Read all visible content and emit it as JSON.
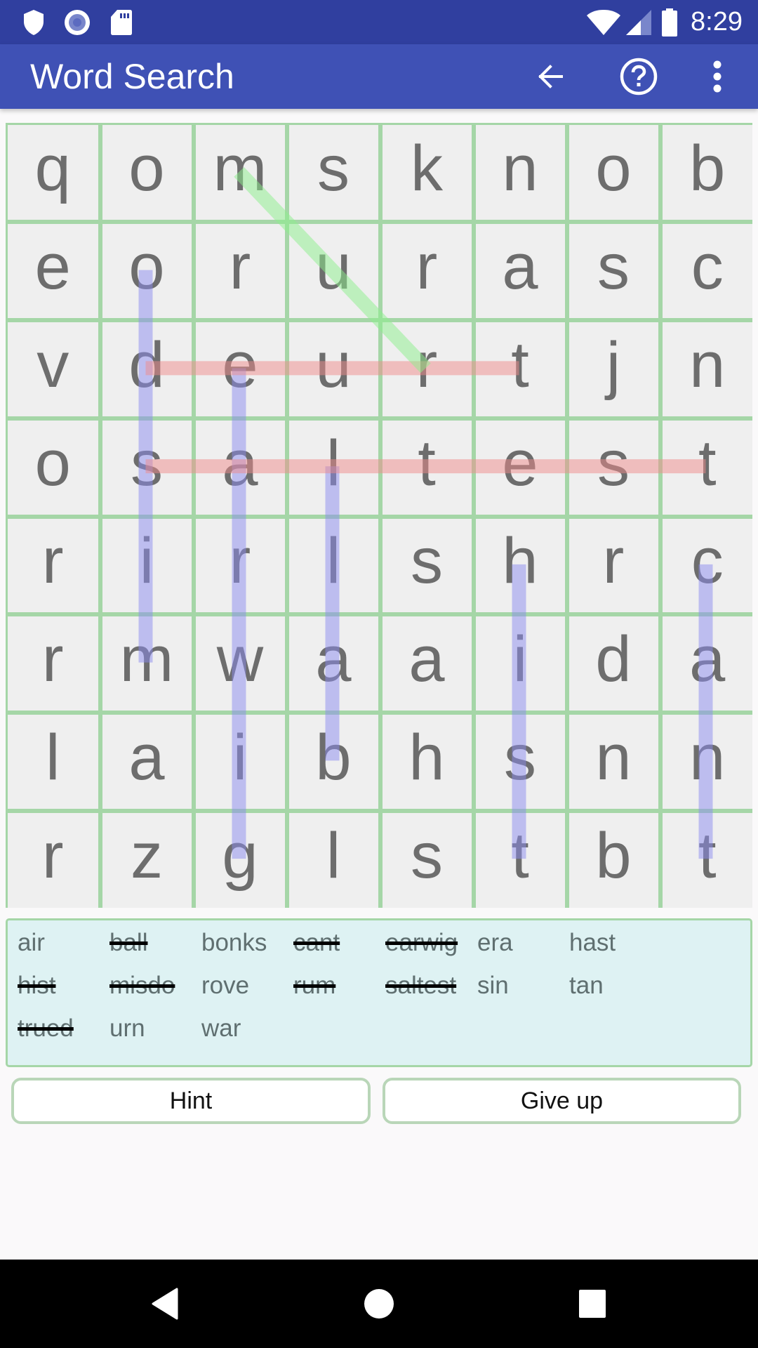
{
  "status_bar": {
    "left_icons": [
      "shield-icon",
      "record-icon",
      "sd-card-icon"
    ],
    "right_icons": [
      "wifi-icon",
      "cell-signal-icon",
      "battery-icon"
    ],
    "time": "8:29"
  },
  "app_bar": {
    "title": "Word Search",
    "actions": [
      {
        "name": "back-arrow-icon",
        "label": "Back"
      },
      {
        "name": "help-icon",
        "label": "Help"
      },
      {
        "name": "more-options-icon",
        "label": "More options"
      }
    ],
    "color": "#3f51b5",
    "status_color": "#303f9f"
  },
  "puzzle": {
    "rows": 8,
    "cols": 8,
    "grid": [
      [
        "q",
        "o",
        "m",
        "s",
        "k",
        "n",
        "o",
        "b"
      ],
      [
        "e",
        "o",
        "r",
        "u",
        "r",
        "a",
        "s",
        "c"
      ],
      [
        "v",
        "d",
        "e",
        "u",
        "r",
        "t",
        "j",
        "n"
      ],
      [
        "o",
        "s",
        "a",
        "l",
        "t",
        "e",
        "s",
        "t"
      ],
      [
        "r",
        "i",
        "r",
        "l",
        "s",
        "h",
        "r",
        "c"
      ],
      [
        "r",
        "m",
        "w",
        "a",
        "a",
        "i",
        "d",
        "a"
      ],
      [
        "l",
        "a",
        "i",
        "b",
        "h",
        "s",
        "n",
        "n"
      ],
      [
        "r",
        "z",
        "g",
        "l",
        "s",
        "t",
        "b",
        "t"
      ]
    ],
    "found_highlights": [
      {
        "word": "misdo",
        "from": [
          1,
          1
        ],
        "to": [
          5,
          1
        ],
        "color": "#8c8cf0"
      },
      {
        "word": "earwig",
        "from": [
          2,
          2
        ],
        "to": [
          7,
          2
        ],
        "color": "#8c8cf0"
      },
      {
        "word": "ball",
        "from": [
          3,
          3
        ],
        "to": [
          6,
          3
        ],
        "color": "#8c8cf0"
      },
      {
        "word": "hist",
        "from": [
          4,
          5
        ],
        "to": [
          7,
          5
        ],
        "color": "#8c8cf0"
      },
      {
        "word": "cant",
        "from": [
          4,
          7
        ],
        "to": [
          7,
          7
        ],
        "color": "#8c8cf0"
      },
      {
        "word": "trued",
        "from": [
          2,
          1
        ],
        "to": [
          2,
          5
        ],
        "color": "#f08c8c"
      },
      {
        "word": "saltest",
        "from": [
          3,
          1
        ],
        "to": [
          3,
          7
        ],
        "color": "#f08c8c"
      },
      {
        "word": "rum",
        "from": [
          0,
          2
        ],
        "to": [
          2,
          4
        ],
        "color": "#8cf08c"
      }
    ]
  },
  "word_list": {
    "columns": 7,
    "words": [
      {
        "text": "air",
        "found": false
      },
      {
        "text": "ball",
        "found": true
      },
      {
        "text": "bonks",
        "found": false
      },
      {
        "text": "cant",
        "found": true
      },
      {
        "text": "earwig",
        "found": true
      },
      {
        "text": "era",
        "found": false
      },
      {
        "text": "hast",
        "found": false
      },
      {
        "text": "hist",
        "found": true
      },
      {
        "text": "misdo",
        "found": true
      },
      {
        "text": "rove",
        "found": false
      },
      {
        "text": "rum",
        "found": true
      },
      {
        "text": "saltest",
        "found": true
      },
      {
        "text": "sin",
        "found": false
      },
      {
        "text": "tan",
        "found": false
      },
      {
        "text": "trued",
        "found": true
      },
      {
        "text": "urn",
        "found": false
      },
      {
        "text": "war",
        "found": false
      }
    ]
  },
  "buttons": {
    "hint": "Hint",
    "give_up": "Give up"
  },
  "nav_bar": {
    "buttons": [
      "back-triangle-icon",
      "home-circle-icon",
      "recents-square-icon"
    ]
  }
}
